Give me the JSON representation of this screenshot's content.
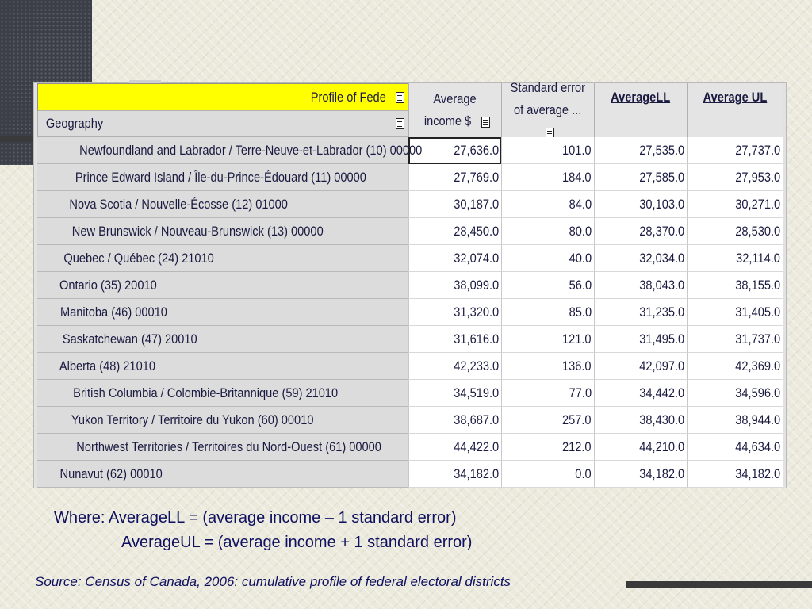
{
  "table": {
    "title": "Profile of Fede",
    "geography_header": "Geography",
    "columns": [
      {
        "line1": "Average",
        "line2": "income $"
      },
      {
        "line1": "Standard error",
        "line2": "of average ..."
      },
      {
        "line1": "AverageLL",
        "line2": ""
      },
      {
        "line1": "Average UL",
        "line2": ""
      }
    ],
    "rows": [
      {
        "geo": "Newfoundland and Labrador / Terre-Neuve-et-Labrador (10)   00000",
        "avg": "27,636.0",
        "se": "101.0",
        "ll": "27,535.0",
        "ul": "27,737.0"
      },
      {
        "geo": "Prince Edward Island / Île-du-Prince-Édouard (11)   00000",
        "avg": "27,769.0",
        "se": "184.0",
        "ll": "27,585.0",
        "ul": "27,953.0"
      },
      {
        "geo": "Nova Scotia / Nouvelle-Écosse (12)   01000",
        "avg": "30,187.0",
        "se": "84.0",
        "ll": "30,103.0",
        "ul": "30,271.0"
      },
      {
        "geo": "New Brunswick / Nouveau-Brunswick (13)   00000",
        "avg": "28,450.0",
        "se": "80.0",
        "ll": "28,370.0",
        "ul": "28,530.0"
      },
      {
        "geo": "Quebec / Québec (24)   21010",
        "avg": "32,074.0",
        "se": "40.0",
        "ll": "32,034.0",
        "ul": "32,114.0"
      },
      {
        "geo": "Ontario (35)   20010",
        "avg": "38,099.0",
        "se": "56.0",
        "ll": "38,043.0",
        "ul": "38,155.0"
      },
      {
        "geo": "Manitoba (46)   00010",
        "avg": "31,320.0",
        "se": "85.0",
        "ll": "31,235.0",
        "ul": "31,405.0"
      },
      {
        "geo": "Saskatchewan (47)   20010",
        "avg": "31,616.0",
        "se": "121.0",
        "ll": "31,495.0",
        "ul": "31,737.0"
      },
      {
        "geo": "Alberta (48)   21010",
        "avg": "42,233.0",
        "se": "136.0",
        "ll": "42,097.0",
        "ul": "42,369.0"
      },
      {
        "geo": "British Columbia / Colombie-Britannique (59)   21010",
        "avg": "34,519.0",
        "se": "77.0",
        "ll": "34,442.0",
        "ul": "34,596.0"
      },
      {
        "geo": "Yukon Territory / Territoire du Yukon (60)   00010",
        "avg": "38,687.0",
        "se": "257.0",
        "ll": "38,430.0",
        "ul": "38,944.0"
      },
      {
        "geo": "Northwest Territories / Territoires du Nord-Ouest (61)   00000",
        "avg": "44,422.0",
        "se": "212.0",
        "ll": "44,210.0",
        "ul": "44,634.0"
      },
      {
        "geo": "Nunavut (62)   00010",
        "avg": "34,182.0",
        "se": "0.0",
        "ll": "34,182.0",
        "ul": "34,182.0"
      }
    ]
  },
  "notes": {
    "line1": "Where: AverageLL = (average income – 1 standard error)",
    "line2": "AverageUL = (average income + 1 standard error)"
  },
  "source": "Source: Census of Canada, 2006: cumulative profile of federal electoral districts",
  "colors": {
    "title_bar": "#ffff00",
    "text": "#1a1a40",
    "note_text": "#101060"
  }
}
